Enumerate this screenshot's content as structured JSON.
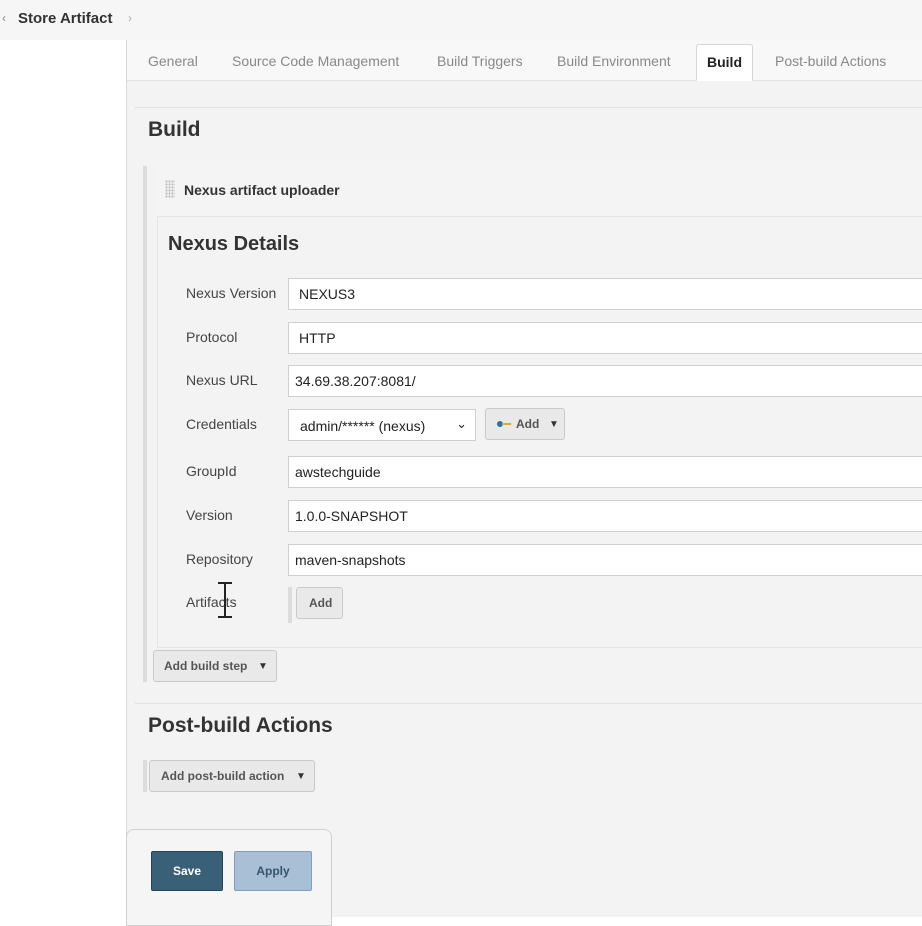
{
  "breadcrumb": {
    "title": "Store Artifact"
  },
  "tabs": [
    {
      "label": "General"
    },
    {
      "label": "Source Code Management"
    },
    {
      "label": "Build Triggers"
    },
    {
      "label": "Build Environment"
    },
    {
      "label": "Build",
      "active": true
    },
    {
      "label": "Post-build Actions"
    }
  ],
  "build": {
    "section_title": "Build",
    "step_title": "Nexus artifact uploader",
    "subsection_title": "Nexus Details",
    "fields": {
      "nexus_version": {
        "label": "Nexus Version",
        "value": "NEXUS3"
      },
      "protocol": {
        "label": "Protocol",
        "value": "HTTP"
      },
      "nexus_url": {
        "label": "Nexus URL",
        "value": "34.69.38.207:8081/"
      },
      "credentials": {
        "label": "Credentials",
        "value": "admin/****** (nexus)",
        "add_label": "Add"
      },
      "group_id": {
        "label": "GroupId",
        "value": "awstechguide"
      },
      "version": {
        "label": "Version",
        "value": "1.0.0-SNAPSHOT"
      },
      "repository": {
        "label": "Repository",
        "value": "maven-snapshots"
      },
      "artifacts": {
        "label": "Artifacts",
        "add_label": "Add"
      }
    },
    "add_build_step_label": "Add build step"
  },
  "post_build": {
    "section_title": "Post-build Actions",
    "add_action_label": "Add post-build action"
  },
  "footer": {
    "save_label": "Save",
    "apply_label": "Apply"
  },
  "colors": {
    "save_bg": "#3a6077",
    "apply_bg": "#a9bfd6"
  }
}
